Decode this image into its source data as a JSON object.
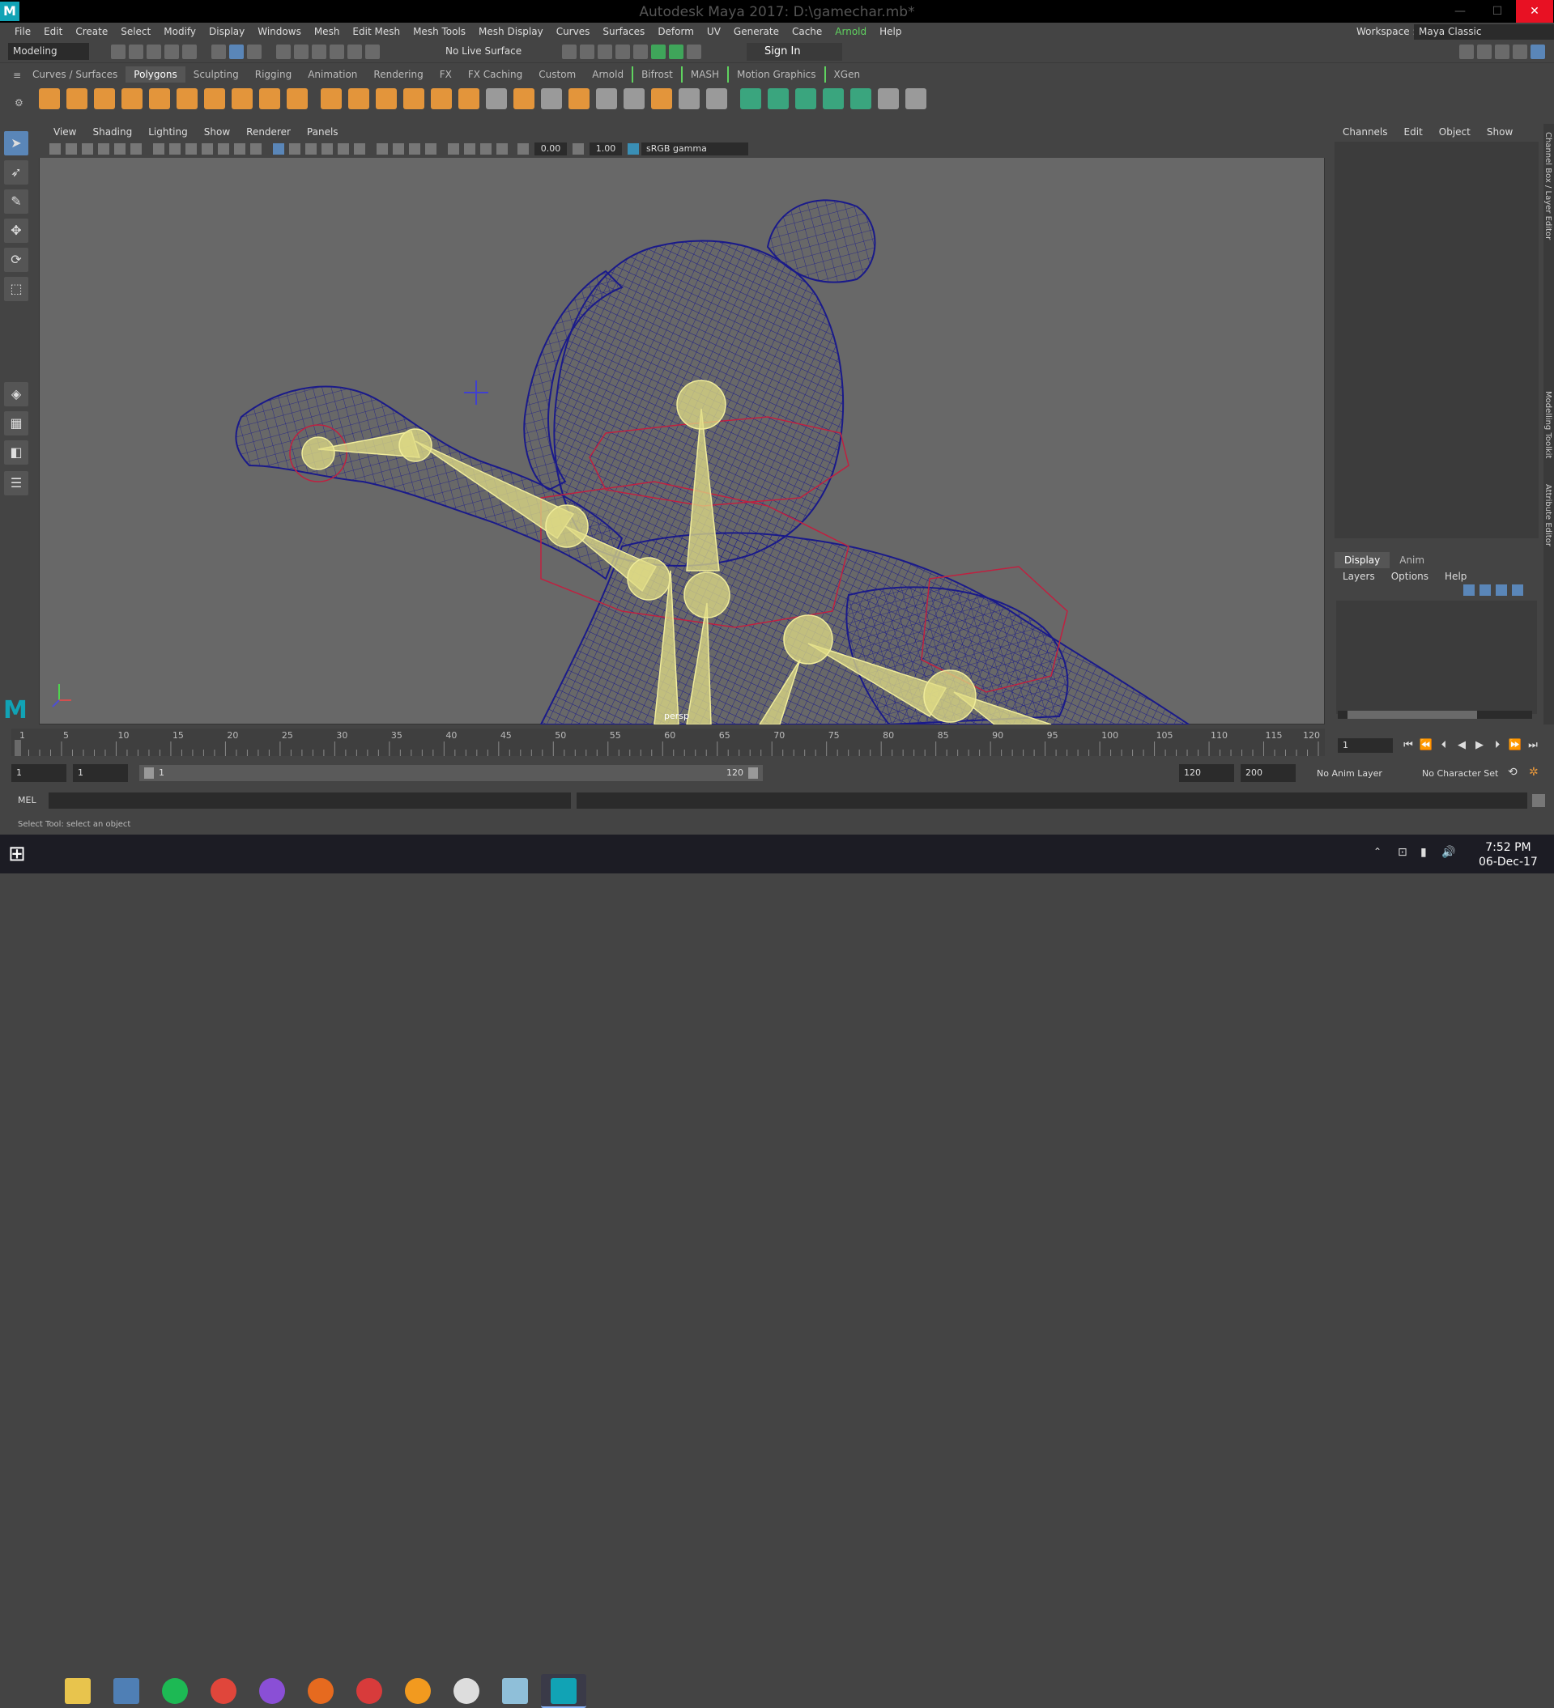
{
  "window": {
    "app_letter": "M",
    "title": "Autodesk Maya 2017: D:\\gamechar.mb*",
    "minimize": "—",
    "maximize": "☐",
    "close": "✕"
  },
  "menubar": [
    "File",
    "Edit",
    "Create",
    "Select",
    "Modify",
    "Display",
    "Windows",
    "Mesh",
    "Edit Mesh",
    "Mesh Tools",
    "Mesh Display",
    "Curves",
    "Surfaces",
    "Deform",
    "UV",
    "Generate",
    "Cache",
    "Arnold",
    "Help"
  ],
  "workspace": {
    "label": "Workspace :",
    "value": "Maya Classic"
  },
  "statusline": {
    "menuset": "Modeling",
    "live_surface": "No Live Surface",
    "sign_in": "Sign In"
  },
  "shelf": {
    "tabs": [
      "Curves / Surfaces",
      "Polygons",
      "Sculpting",
      "Rigging",
      "Animation",
      "Rendering",
      "FX",
      "FX Caching",
      "Custom",
      "Arnold",
      "Bifrost",
      "MASH",
      "Motion Graphics",
      "XGen"
    ],
    "active_tab": "Polygons"
  },
  "viewport": {
    "menus": [
      "View",
      "Shading",
      "Lighting",
      "Show",
      "Renderer",
      "Panels"
    ],
    "exposure": "0.00",
    "gamma": "1.00",
    "color_space": "sRGB gamma",
    "camera_label": "persp"
  },
  "channel_box": {
    "menus": [
      "Channels",
      "Edit",
      "Object",
      "Show"
    ],
    "layer_tabs": [
      "Display",
      "Anim"
    ],
    "layer_menus": [
      "Layers",
      "Options",
      "Help"
    ],
    "side_tabs": [
      "Channel Box / Layer Editor",
      "Modelling Toolkit",
      "Attribute Editor"
    ]
  },
  "timeline": {
    "ticks": [
      1,
      5,
      10,
      15,
      20,
      25,
      30,
      35,
      40,
      45,
      50,
      55,
      60,
      65,
      70,
      75,
      80,
      85,
      90,
      95,
      100,
      105,
      110,
      115,
      120
    ],
    "start_tick": 1,
    "end_tick": 120,
    "current_frame": "1"
  },
  "range": {
    "start": "1",
    "playback_start": "1",
    "slider_start": "1",
    "slider_end": "120",
    "playback_end": "120",
    "end": "200",
    "anim_layer": "No Anim Layer",
    "character_set": "No Character Set"
  },
  "command": {
    "mode": "MEL",
    "help_text": "Select Tool: select an object"
  },
  "taskbar": {
    "time": "7:52 PM",
    "date": "06-Dec-17",
    "apps": [
      {
        "name": "file-explorer",
        "color": "#e8c44d"
      },
      {
        "name": "calculator",
        "color": "#4f7fb5"
      },
      {
        "name": "spotify",
        "color": "#1db954"
      },
      {
        "name": "chrome",
        "color": "#e0463b"
      },
      {
        "name": "nexus",
        "color": "#8a4fd6"
      },
      {
        "name": "firefox",
        "color": "#e66a1f"
      },
      {
        "name": "popcorn",
        "color": "#d83b3b"
      },
      {
        "name": "sublime",
        "color": "#f29a1f"
      },
      {
        "name": "unreal",
        "color": "#dddddd"
      },
      {
        "name": "notes",
        "color": "#8fbfd9"
      },
      {
        "name": "maya",
        "color": "#11a3b5"
      }
    ]
  },
  "colors": {
    "viewport_bg": "#686868",
    "wireframe": "#1a1a8a",
    "joint": "#e0dc86",
    "accent": "#11a3b5",
    "arnold": "#5fd35f"
  }
}
